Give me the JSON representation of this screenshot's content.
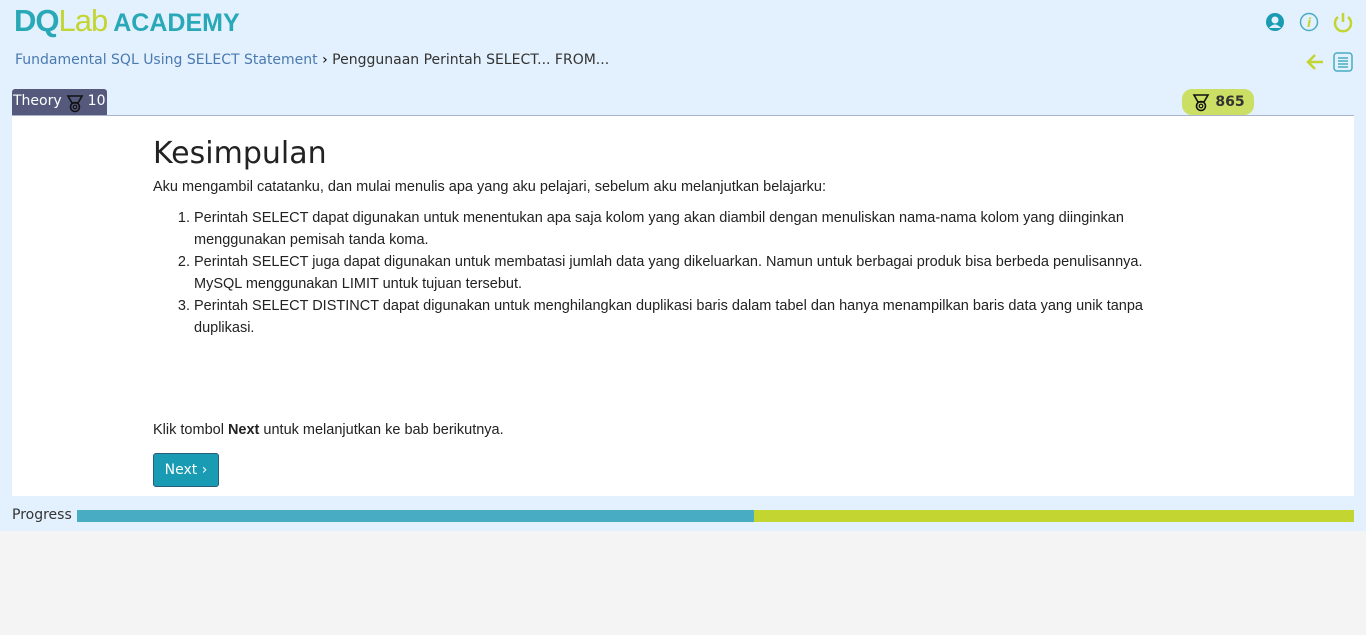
{
  "logo": {
    "part1": "DQ",
    "part2": "Lab",
    "part3": "ACADEMY"
  },
  "breadcrumb": {
    "course": "Fundamental SQL Using SELECT Statement",
    "separator": "›",
    "current": "Penggunaan Perintah SELECT... FROM..."
  },
  "tab": {
    "label": "Theory",
    "points": "10"
  },
  "score": "865",
  "content": {
    "title": "Kesimpulan",
    "intro": "Aku mengambil catatanku, dan mulai menulis apa yang aku pelajari, sebelum aku melanjutkan belajarku:",
    "items": [
      "Perintah SELECT dapat digunakan untuk menentukan apa saja kolom yang akan diambil dengan menuliskan nama-nama kolom yang diinginkan menggunakan pemisah tanda koma.",
      "Perintah SELECT juga dapat digunakan untuk membatasi jumlah data yang dikeluarkan. Namun untuk berbagai produk bisa berbeda penulisannya. MySQL menggunakan LIMIT untuk tujuan tersebut.",
      "Perintah SELECT DISTINCT dapat digunakan untuk menghilangkan duplikasi baris dalam tabel dan hanya menampilkan baris data yang unik tanpa duplikasi."
    ],
    "klik_pre": "Klik tombol ",
    "klik_bold": "Next",
    "klik_post": " untuk melanjutkan ke bab berikutnya."
  },
  "next_label": "Next ›",
  "progress": {
    "label": "Progress",
    "percent": 53
  },
  "colors": {
    "teal": "#1a9bb4",
    "lime": "#c3d531",
    "tab": "#555a7d"
  }
}
